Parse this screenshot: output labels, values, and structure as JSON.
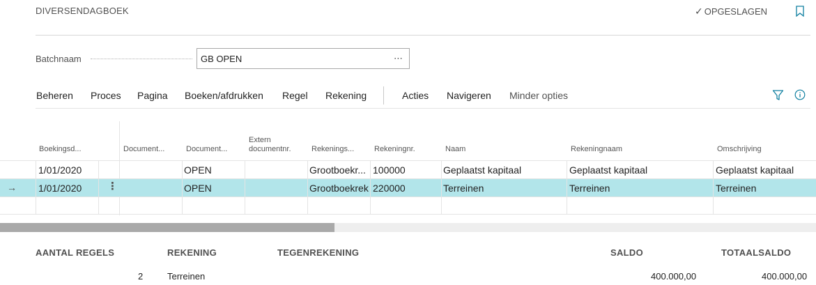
{
  "header": {
    "title": "DIVERSENDAGBOEK",
    "saved_label": "OPGESLAGEN",
    "icons": {
      "saved": "check-icon",
      "bookmark": "bookmark-icon"
    }
  },
  "batch": {
    "label": "Batchnaam",
    "value": "GB OPEN",
    "more": "⋯"
  },
  "toolbar": {
    "items": [
      "Beheren",
      "Proces",
      "Pagina",
      "Boeken/afdrukken",
      "Regel",
      "Rekening",
      "Acties",
      "Navigeren",
      "Minder opties"
    ],
    "icons": {
      "filter": "filter-icon",
      "info": "info-icon"
    }
  },
  "grid": {
    "headers": {
      "posting_date": "Boekingsd...",
      "doc_type": "Document...",
      "doc_no": "Document...",
      "ext_doc_line1": "Extern",
      "ext_doc_line2": "documentnr.",
      "account_type": "Rekenings...",
      "account_no": "Rekeningnr.",
      "name": "Naam",
      "account_name": "Rekeningnaam",
      "description": "Omschrijving"
    },
    "rows": [
      {
        "posting_date": "1/01/2020",
        "doc_type": "",
        "doc_no": "OPEN",
        "ext_doc": "",
        "account_type": "Grootboekr...",
        "account_no": "100000",
        "name": "Geplaatst kapitaal",
        "account_name": "Geplaatst kapitaal",
        "description": "Geplaatst kapitaal"
      },
      {
        "posting_date": "1/01/2020",
        "doc_type": "",
        "doc_no": "OPEN",
        "ext_doc": "",
        "account_type": "Grootboekrek",
        "account_no": "220000",
        "name": "Terreinen",
        "account_name": "Terreinen",
        "description": "Terreinen",
        "selected": true
      }
    ],
    "row_marker": "→",
    "row_menu": "⋮",
    "selection_color": "#b2e5ea"
  },
  "scrollbar": {
    "position": 0.41
  },
  "summary": {
    "headers": {
      "lines": "AANTAL REGELS",
      "account": "REKENING",
      "counter": "TEGENREKENING",
      "balance": "SALDO",
      "total": "TOTAALSALDO"
    },
    "values": {
      "lines": "2",
      "account": "Terreinen",
      "counter": "",
      "balance": "400.000,00",
      "total": "400.000,00"
    }
  },
  "colors": {
    "accent": "#0f7fa0"
  }
}
